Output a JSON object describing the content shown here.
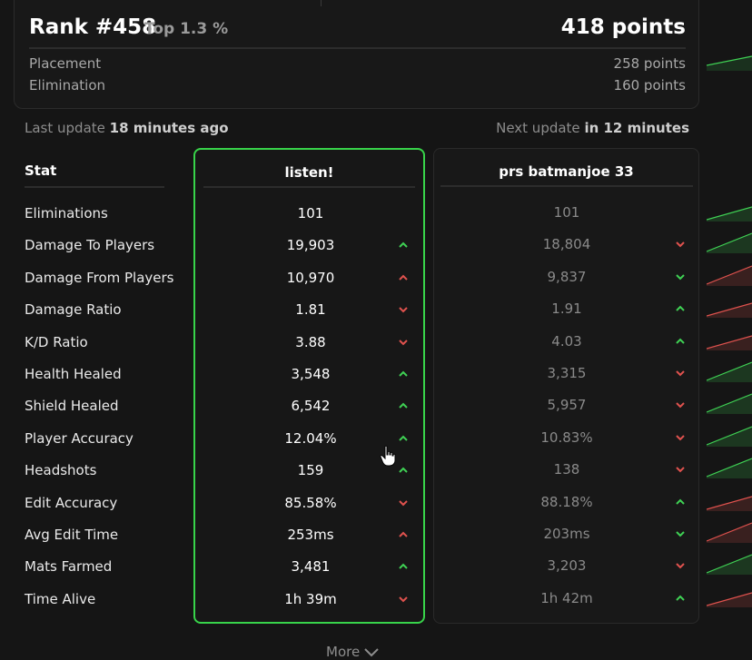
{
  "rank": {
    "title": "Rank #458",
    "top": "Top 1.3 %",
    "points": "418 points",
    "rows": [
      {
        "label": "Placement",
        "value": "258 points"
      },
      {
        "label": "Elimination",
        "value": "160 points"
      }
    ]
  },
  "updates": {
    "last_prefix": "Last update",
    "last_value": "18 minutes ago",
    "next_prefix": "Next update",
    "next_value": "in 12 minutes"
  },
  "stat_header": "Stat",
  "players": [
    {
      "name": "listen!"
    },
    {
      "name": "prs batmanjoe 33"
    }
  ],
  "stats": [
    {
      "label": "Eliminations",
      "p1": "101",
      "p1_arrow": "none",
      "p2": "101",
      "p2_arrow": "none"
    },
    {
      "label": "Damage To Players",
      "p1": "19,903",
      "p1_arrow": "up-green",
      "p2": "18,804",
      "p2_arrow": "down-red"
    },
    {
      "label": "Damage From Players",
      "p1": "10,970",
      "p1_arrow": "up-red",
      "p2": "9,837",
      "p2_arrow": "down-green"
    },
    {
      "label": "Damage Ratio",
      "p1": "1.81",
      "p1_arrow": "down-red",
      "p2": "1.91",
      "p2_arrow": "up-green"
    },
    {
      "label": "K/D Ratio",
      "p1": "3.88",
      "p1_arrow": "down-red",
      "p2": "4.03",
      "p2_arrow": "up-green"
    },
    {
      "label": "Health Healed",
      "p1": "3,548",
      "p1_arrow": "up-green",
      "p2": "3,315",
      "p2_arrow": "down-red"
    },
    {
      "label": "Shield Healed",
      "p1": "6,542",
      "p1_arrow": "up-green",
      "p2": "5,957",
      "p2_arrow": "down-red"
    },
    {
      "label": "Player Accuracy",
      "p1": "12.04%",
      "p1_arrow": "up-green",
      "p2": "10.83%",
      "p2_arrow": "down-red"
    },
    {
      "label": "Headshots",
      "p1": "159",
      "p1_arrow": "up-green",
      "p2": "138",
      "p2_arrow": "down-red"
    },
    {
      "label": "Edit Accuracy",
      "p1": "85.58%",
      "p1_arrow": "down-red",
      "p2": "88.18%",
      "p2_arrow": "up-green"
    },
    {
      "label": "Avg Edit Time",
      "p1": "253ms",
      "p1_arrow": "up-red",
      "p2": "203ms",
      "p2_arrow": "down-green"
    },
    {
      "label": "Mats Farmed",
      "p1": "3,481",
      "p1_arrow": "up-green",
      "p2": "3,203",
      "p2_arrow": "down-red"
    },
    {
      "label": "Time Alive",
      "p1": "1h 39m",
      "p1_arrow": "down-red",
      "p2": "1h 42m",
      "p2_arrow": "up-green"
    }
  ],
  "more_label": "More",
  "colors": {
    "green": "#3fd154",
    "red": "#e0524e",
    "accent_border": "#38d44a"
  },
  "icons": {
    "arrow_up": "chevron-up-icon",
    "arrow_down": "chevron-down-icon",
    "more": "chevron-down-icon",
    "cursor": "hand-pointer-icon"
  }
}
